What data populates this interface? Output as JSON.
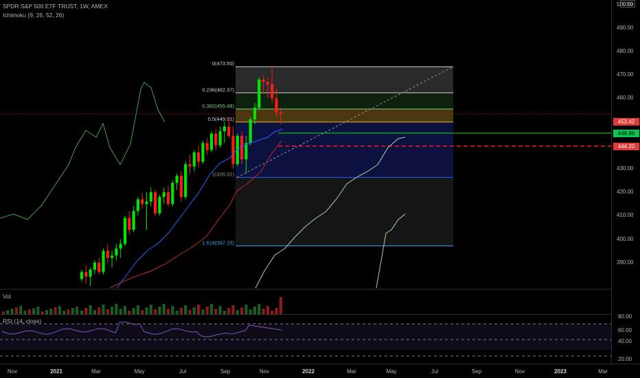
{
  "header": {
    "symbol_title": "SPDR S&P 500 ETF TRUST, 1W, AMEX",
    "indicator_label": "Ichimoku (9, 26, 52, 26)"
  },
  "volume_pane": {
    "label": "Vol"
  },
  "rsi_pane": {
    "label": "RSI (14, close)",
    "ticks": [
      "80.00",
      "60.00",
      "40.00",
      "20.00"
    ]
  },
  "price_axis": {
    "currency": "USD",
    "ticks": [
      "500.00",
      "490.00",
      "480.00",
      "470.00",
      "460.00",
      "450.00",
      "440.00",
      "430.00",
      "420.00",
      "410.00",
      "400.00",
      "390.00"
    ],
    "last_price_tag": "453.42",
    "green_tag": "448.96",
    "red_tag": "444.20"
  },
  "time_axis": {
    "labels": [
      {
        "text": "Nov",
        "bold": false
      },
      {
        "text": "2021",
        "bold": true
      },
      {
        "text": "Mar",
        "bold": false
      },
      {
        "text": "May",
        "bold": false
      },
      {
        "text": "Jul",
        "bold": false
      },
      {
        "text": "Sep",
        "bold": false
      },
      {
        "text": "Nov",
        "bold": false
      },
      {
        "text": "2022",
        "bold": true
      },
      {
        "text": "Mar",
        "bold": false
      },
      {
        "text": "May",
        "bold": false
      },
      {
        "text": "Jul",
        "bold": false
      },
      {
        "text": "Sep",
        "bold": false
      },
      {
        "text": "Nov",
        "bold": false
      },
      {
        "text": "2023",
        "bold": true
      },
      {
        "text": "Mar",
        "bold": false
      }
    ]
  },
  "fibonacci": {
    "levels": [
      {
        "label": "0(473.50)",
        "value": 473.5,
        "color": "#d1d4dc"
      },
      {
        "label": "0.236(462.37)",
        "value": 462.37,
        "color": "#d1d4dc"
      },
      {
        "label": "0.382(455.48)",
        "value": 455.48,
        "color": "#81c784"
      },
      {
        "label": "0.5(449.91)",
        "value": 449.91,
        "color": "#d1d4dc"
      },
      {
        "label": "1(426.31)",
        "value": 426.31,
        "color": "#9598a1"
      },
      {
        "label": "1.618(397.15)",
        "value": 397.15,
        "color": "#42a5f5"
      }
    ]
  },
  "colors": {
    "up": "#00e600",
    "down": "#ff1a1a",
    "kijun": "#c62828",
    "tenkan": "#2962ff",
    "chikou": "#43a047",
    "span_line": "#a5d6a7",
    "rsi": "#7e57c2"
  },
  "chart_data": {
    "type": "candlestick",
    "series": [
      {
        "name": "SPDR S&P 500 ETF TRUST",
        "ohlc": [
          [
            383,
            387,
            382,
            386
          ],
          [
            386,
            389,
            381,
            384
          ],
          [
            384,
            388,
            380,
            387
          ],
          [
            387,
            391,
            385,
            390
          ],
          [
            390,
            392,
            385,
            386
          ],
          [
            386,
            396,
            385,
            395
          ],
          [
            395,
            398,
            390,
            392
          ],
          [
            392,
            395,
            388,
            393
          ],
          [
            393,
            398,
            391,
            396
          ],
          [
            396,
            400,
            392,
            398
          ],
          [
            398,
            410,
            397,
            409
          ],
          [
            409,
            412,
            402,
            404
          ],
          [
            404,
            414,
            403,
            412
          ],
          [
            412,
            418,
            410,
            417
          ],
          [
            417,
            420,
            413,
            415
          ],
          [
            415,
            420,
            404,
            416
          ],
          [
            416,
            422,
            414,
            420
          ],
          [
            420,
            421,
            410,
            411
          ],
          [
            411,
            419,
            410,
            418
          ],
          [
            418,
            422,
            415,
            420
          ],
          [
            420,
            423,
            414,
            415
          ],
          [
            415,
            425,
            414,
            424
          ],
          [
            424,
            428,
            421,
            427
          ],
          [
            427,
            429,
            416,
            418
          ],
          [
            418,
            433,
            417,
            432
          ],
          [
            432,
            436,
            428,
            431
          ],
          [
            431,
            438,
            429,
            437
          ],
          [
            437,
            440,
            431,
            433
          ],
          [
            433,
            442,
            432,
            441
          ],
          [
            441,
            443,
            436,
            438
          ],
          [
            438,
            446,
            437,
            445
          ],
          [
            445,
            447,
            438,
            440
          ],
          [
            440,
            448,
            439,
            446
          ],
          [
            446,
            450,
            441,
            448
          ],
          [
            448,
            452,
            443,
            444
          ],
          [
            444,
            448,
            430,
            432
          ],
          [
            432,
            445,
            431,
            444
          ],
          [
            444,
            446,
            432,
            434
          ],
          [
            434,
            444,
            428,
            441
          ],
          [
            441,
            452,
            440,
            451
          ],
          [
            451,
            458,
            449,
            456
          ],
          [
            456,
            469,
            455,
            468
          ],
          [
            468,
            470,
            462,
            467
          ],
          [
            467,
            469,
            460,
            466
          ],
          [
            466,
            473.5,
            458,
            460
          ],
          [
            460,
            464,
            452,
            454
          ],
          [
            454,
            456,
            449,
            453.42
          ]
        ]
      }
    ],
    "ylim": [
      387,
      502
    ]
  }
}
